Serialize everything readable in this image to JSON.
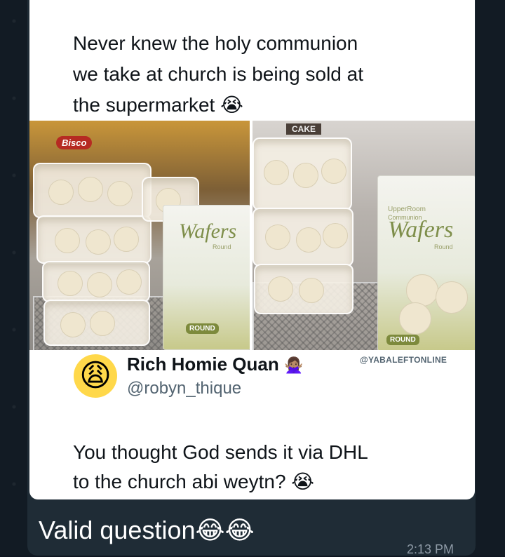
{
  "tweet": {
    "text_line1": "Never knew the holy communion",
    "text_line2": "we take at church is being sold at",
    "text_line3": "the supermarket",
    "emoji": "😭"
  },
  "photo": {
    "watermark": "@YABALEFTONLINE",
    "left_brand": "Bisco",
    "right_label": "CAKE",
    "pack_title": "Wafers",
    "pack_subtitle": "Round",
    "pack_header": "UpperRoom",
    "pack_header2": "Communion",
    "pack_badge": "ROUND"
  },
  "reply": {
    "display_name": "Rich Homie Quan",
    "name_emoji": "🙅🏽‍♀️",
    "avatar_emoji": "😩",
    "handle": "@robyn_thique",
    "text_line1": "You thought God sends it via DHL",
    "text_line2": "to the church abi weytn?",
    "emoji": "😭"
  },
  "message": {
    "caption": "Valid question",
    "caption_emoji": "😂😂",
    "time": "2:13 PM"
  }
}
